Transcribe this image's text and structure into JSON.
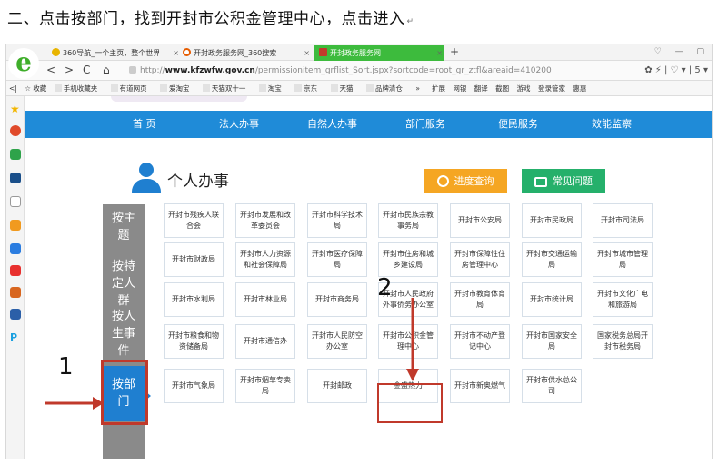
{
  "heading": {
    "text": "二、点击按部门，找到开封市公积金管理中心，点击进入",
    "mark": "↵"
  },
  "browser": {
    "logo": "e",
    "tabs": [
      {
        "label": "360导航_一个主页，整个世界",
        "close": "×"
      },
      {
        "label": "开封政务服务网_360搜索",
        "close": "×"
      },
      {
        "label": "开封政务服务网",
        "close": "×"
      }
    ],
    "add_tab": "+",
    "window_controls": "♡ — ▢",
    "nav": {
      "back": "<",
      "forward": ">",
      "reload": "C",
      "home": "⌂"
    },
    "address": {
      "prefix": "http://",
      "domain": "www.kfzwfw.gov.cn",
      "path": "/permissionitem_grflist_Sort.jspx?sortcode=root_gr_ztfl&areaid=410200"
    },
    "nav_right": "✿ ⚡ | ♡ ▾ | 5 ▾",
    "bookmarks_left": [
      "<|",
      "☆ 收藏",
      "手机收藏夹",
      "有道网页",
      "爱淘宝",
      "天猫双十一",
      "淘宝",
      "京东",
      "天猫",
      "品牌清仓",
      "»"
    ],
    "bookmarks_right": [
      "扩展",
      "网银",
      "翻译",
      "截图",
      "游戏",
      "登录管家",
      "惠惠"
    ]
  },
  "site": {
    "nav": [
      "首 页",
      "法人办事",
      "自然人办事",
      "部门服务",
      "便民服务",
      "效能监察"
    ],
    "title": "个人办事",
    "btn_progress": "进度查询",
    "btn_faq": "常见问题",
    "categories": [
      "按主题",
      "按特定人群",
      "按人生事件"
    ],
    "category_active": "按部门",
    "grid": [
      [
        "开封市残疾人联合会",
        "开封市发展和改革委员会",
        "开封市科学技术局",
        "开封市民族宗教事务局",
        "开封市公安局",
        "开封市民政局",
        "开封市司法局"
      ],
      [
        "开封市财政局",
        "开封市人力资源和社会保障局",
        "开封市医疗保障局",
        "开封市住房和城乡建设局",
        "开封市保障性住房管理中心",
        "开封市交通运输局",
        "开封市城市管理局"
      ],
      [
        "开封市水利局",
        "开封市林业局",
        "开封市商务局",
        "开封市人民政府外事侨务办公室",
        "开封市教育体育局",
        "开封市统计局",
        "开封市文化广电和旅游局"
      ],
      [
        "开封市粮食和物资储备局",
        "开封市通信办",
        "开封市人民防空办公室",
        "开封市公积金管理中心",
        "开封市不动产登记中心",
        "开封市国家安全局",
        "国家税务总局开封市税务局"
      ],
      [
        "开封市气象局",
        "开封市烟草专卖局",
        "开封邮政",
        "金盛热力",
        "开封市新奥燃气",
        "开封市供水总公司"
      ]
    ]
  },
  "annotations": {
    "step1": "1",
    "step2": "2"
  },
  "colors": {
    "nav_blue": "#1f8bd8",
    "active_blue": "#1f7fd0",
    "orange": "#f5a623",
    "green": "#25b06b",
    "annotation_red": "#c0392b",
    "category_gray": "#8a8a8a"
  }
}
